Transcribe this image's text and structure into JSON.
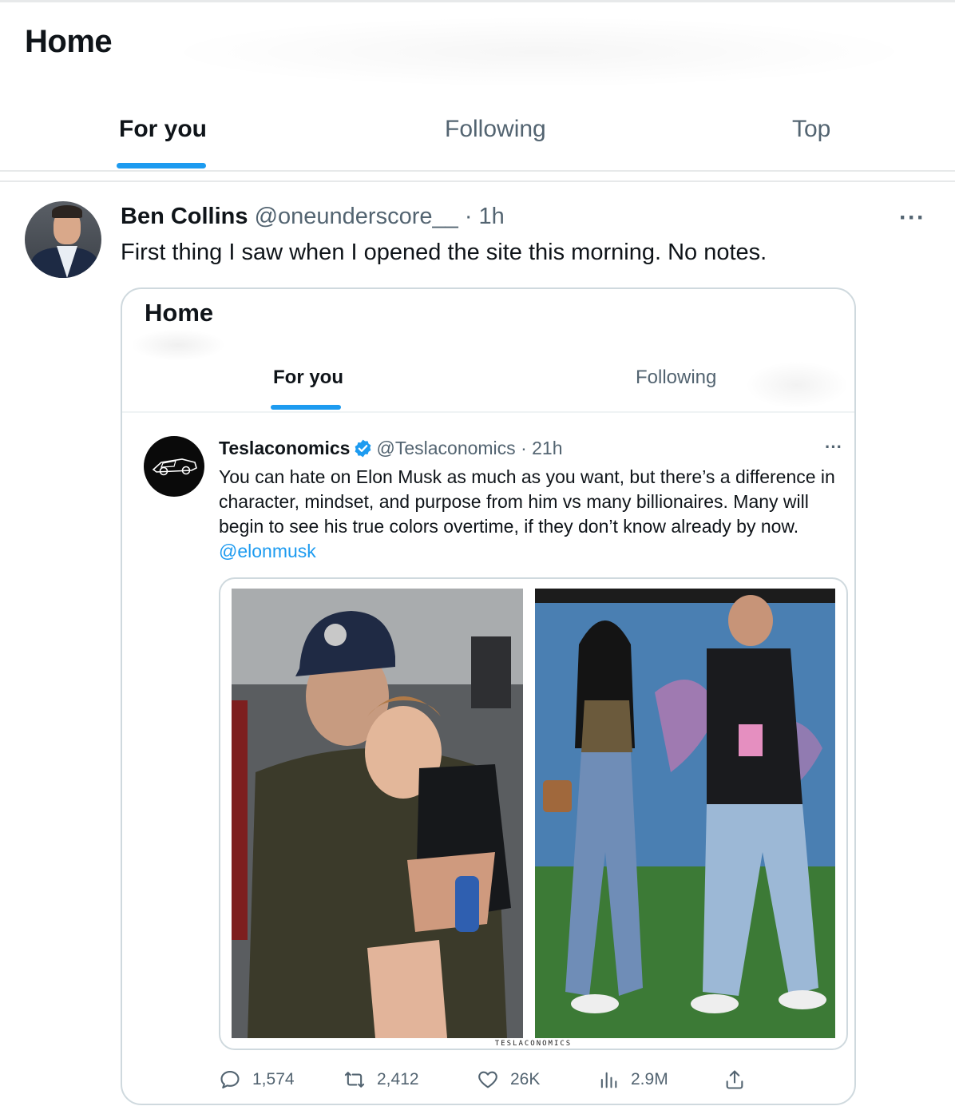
{
  "header": {
    "title": "Home",
    "tabs": [
      {
        "label": "For you",
        "active": true
      },
      {
        "label": "Following",
        "active": false
      },
      {
        "label": "Top",
        "active": false
      }
    ]
  },
  "tweet": {
    "author_name": "Ben Collins",
    "author_handle": "@oneunderscore__",
    "time": "· 1h",
    "more_icon": "more-icon",
    "text": "First thing I saw when I opened the site this morning. No notes."
  },
  "embedded_screenshot": {
    "title": "Home",
    "tabs": [
      {
        "label": "For you",
        "active": true
      },
      {
        "label": "Following",
        "active": false
      }
    ],
    "tweet": {
      "author_name": "Teslaconomics",
      "verified": true,
      "author_handle": "@Teslaconomics",
      "time": "· 21h",
      "text": "You can hate on Elon Musk as much as you want, but there’s a difference in character, mindset, and purpose from him vs many billionaires. Many will begin to see his true colors overtime, if they don’t know already by now. ",
      "mention": "@elonmusk",
      "watermark": "TESLACONOMICS",
      "actions": {
        "replies": "1,574",
        "reposts": "2,412",
        "likes": "26K",
        "views": "2.9M"
      }
    }
  },
  "colors": {
    "accent": "#1d9bf0",
    "text_primary": "#0f1419",
    "text_secondary": "#536471",
    "border": "#cfd9de"
  }
}
